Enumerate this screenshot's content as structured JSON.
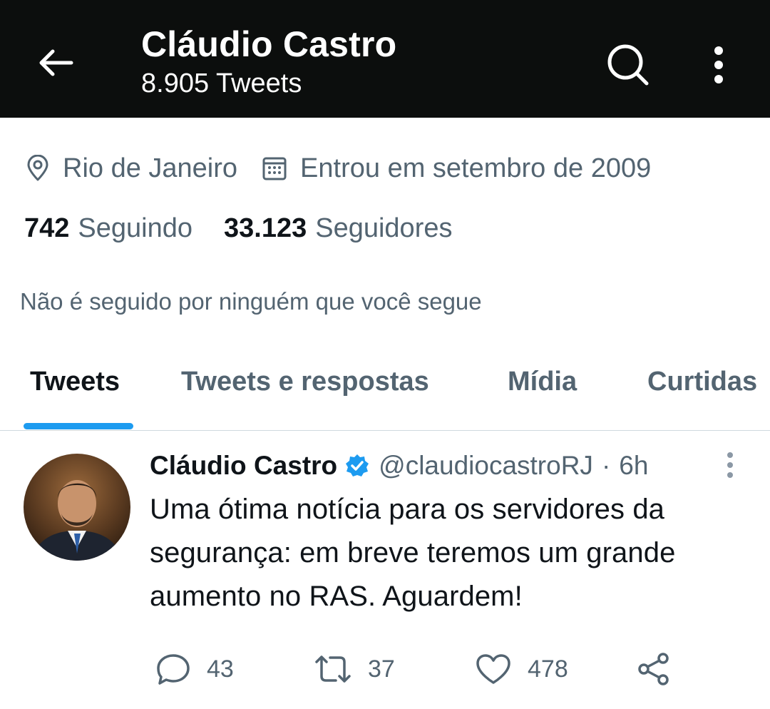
{
  "header": {
    "title": "Cláudio Castro",
    "tweet_count": "8.905 Tweets",
    "back_icon": "back-arrow-icon",
    "search_icon": "search-icon",
    "more_icon": "more-vertical-icon",
    "background": "#0c0e0d"
  },
  "profile": {
    "location": "Rio de Janeiro",
    "joined": "Entrou em setembro de 2009",
    "following_count": "742",
    "following_label": "Seguindo",
    "followers_count": "33.123",
    "followers_label": "Seguidores",
    "not_followed_text": "Não é seguido por ninguém que você segue"
  },
  "tabs": [
    {
      "label": "Tweets",
      "active": true
    },
    {
      "label": "Tweets e respostas",
      "active": false
    },
    {
      "label": "Mídia",
      "active": false
    },
    {
      "label": "Curtidas",
      "active": false
    }
  ],
  "tweet": {
    "name": "Cláudio Castro",
    "verified": true,
    "handle": "@claudiocastroRJ",
    "separator": "·",
    "time": "6h",
    "lines": [
      "Uma ótima notícia para os servidores da",
      "segurança: em breve teremos um grande",
      "aumento no RAS. Aguardem!"
    ],
    "replies": "43",
    "retweets": "37",
    "likes": "478"
  },
  "colors": {
    "accent": "#1d9bf0",
    "secondary_text": "#536471",
    "primary_text": "#0f1419"
  }
}
